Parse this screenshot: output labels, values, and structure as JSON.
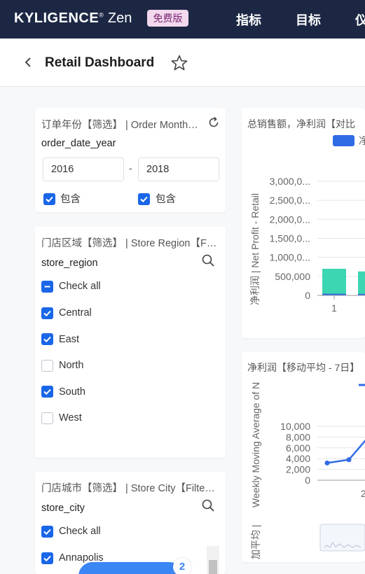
{
  "app": {
    "logo_main": "KYLIGENCE",
    "logo_reg": "®",
    "logo_zen": " Zen",
    "edition_badge": "免费版",
    "nav": [
      "指标",
      "目标",
      "仪"
    ]
  },
  "header": {
    "title": "Retail Dashboard"
  },
  "filters": {
    "order_year": {
      "title": "订单年份【筛选】 | Order Month【Filter】",
      "field": "order_date_year",
      "from": "2016",
      "separator": "-",
      "to": "2018",
      "include_from": "包含",
      "include_to": "包含"
    },
    "store_region": {
      "title": "门店区域【筛选】 | Store Region【Filter】",
      "field": "store_region",
      "options": [
        {
          "label": "Check all",
          "state": "partial"
        },
        {
          "label": "Central",
          "state": "checked"
        },
        {
          "label": "East",
          "state": "checked"
        },
        {
          "label": "North",
          "state": "unchecked"
        },
        {
          "label": "South",
          "state": "checked"
        },
        {
          "label": "West",
          "state": "unchecked"
        }
      ]
    },
    "store_city": {
      "title": "门店城市【筛选】 | Store City【Filter】",
      "field": "store_city",
      "options": [
        {
          "label": "Check all",
          "state": "checked"
        },
        {
          "label": "Annapolis",
          "state": "checked"
        }
      ]
    }
  },
  "charts": {
    "sales_profit": {
      "title": "总销售额，净利润【对比",
      "legend_partial": "净",
      "ylabel": "净利润 | Net Profit - Retail",
      "ticks": [
        "3,000,0...",
        "2,500,0...",
        "2,000,0...",
        "1,500,0...",
        "1,000,0...",
        "500,000",
        "0"
      ],
      "x_ticks": [
        "1"
      ]
    },
    "moving_avg": {
      "title": "净利润【移动平均 - 7日】",
      "ylabel": "Weekly Moving Average of N",
      "ylabel2": "加平均 |",
      "ticks": [
        "10,000",
        "8,000",
        "6,000",
        "4,000",
        "2,000",
        "0"
      ],
      "x_ticks": [
        "2"
      ]
    }
  },
  "chart_data": [
    {
      "type": "bar",
      "title": "总销售额，净利润【对比",
      "ylabel": "净利润 | Net Profit - Retail",
      "ylim": [
        0,
        3000000
      ],
      "categories": [
        "1",
        ""
      ],
      "series": [
        {
          "values": [
            700000,
            630000
          ]
        },
        {
          "values": [
            45000,
            40000
          ]
        }
      ],
      "colors": [
        "#3dd6b2",
        "#2f6be4"
      ],
      "grid": true
    },
    {
      "type": "line",
      "title": "净利润【移动平均 - 7日】",
      "ylabel": "Weekly Moving Average of N",
      "ylim": [
        0,
        10000
      ],
      "x": [
        0,
        1,
        2
      ],
      "values": [
        3200,
        3800,
        8200
      ],
      "colors": [
        "#2f6be4"
      ],
      "grid": true
    }
  ],
  "fab": {
    "count": "2"
  },
  "colors": {
    "topbar": "#1c2744",
    "accent": "#1a66e8",
    "teal": "#3dd6b2",
    "blue": "#2f6be4"
  }
}
